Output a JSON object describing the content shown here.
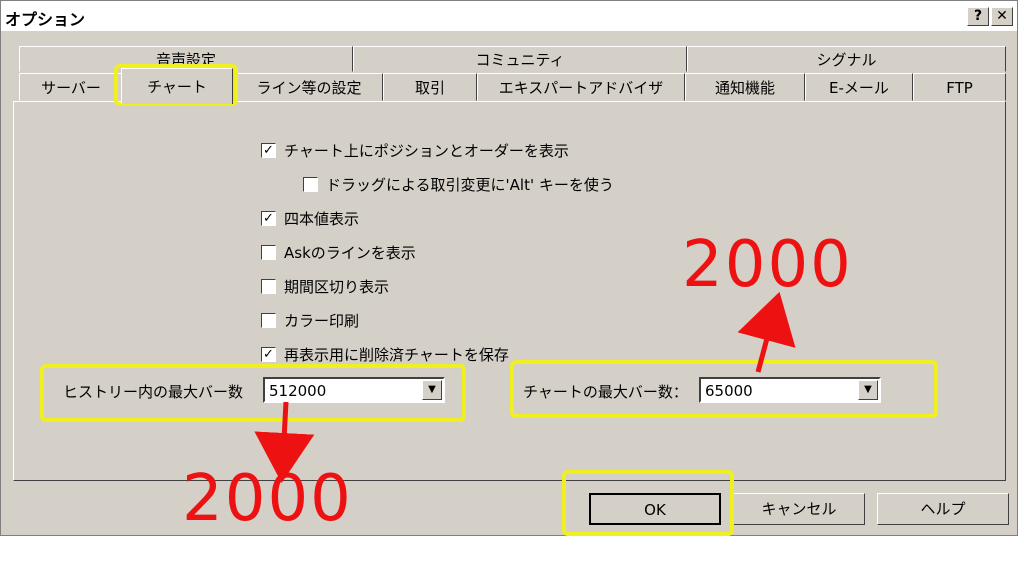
{
  "window": {
    "title": "オプション",
    "help_label": "?",
    "close_label": "✕"
  },
  "tabs_row1": [
    {
      "label": "音声設定"
    },
    {
      "label": "コミュニティ"
    },
    {
      "label": "シグナル"
    }
  ],
  "tabs_row2": [
    {
      "label": "サーバー"
    },
    {
      "label": "チャート"
    },
    {
      "label": "ライン等の設定"
    },
    {
      "label": "取引"
    },
    {
      "label": "エキスパートアドバイザ"
    },
    {
      "label": "通知機能"
    },
    {
      "label": "E-メール"
    },
    {
      "label": "FTP"
    }
  ],
  "selected_tab": "チャート",
  "checkboxes": [
    {
      "label": "チャート上にポジションとオーダーを表示",
      "checked": true,
      "mark": "✓"
    },
    {
      "label": "ドラッグによる取引変更に'Alt' キーを使う",
      "checked": false,
      "mark": ""
    },
    {
      "label": "四本値表示",
      "checked": true,
      "mark": "✓"
    },
    {
      "label": "Askのラインを表示",
      "checked": false,
      "mark": ""
    },
    {
      "label": "期間区切り表示",
      "checked": false,
      "mark": ""
    },
    {
      "label": "カラー印刷",
      "checked": false,
      "mark": ""
    },
    {
      "label": "再表示用に削除済チャートを保存",
      "checked": true,
      "mark": "✓"
    }
  ],
  "history_bars": {
    "label": "ヒストリー内の最大バー数",
    "value": "512000",
    "arrow": "▼"
  },
  "chart_bars": {
    "label": "チャートの最大バー数：",
    "value": "65000",
    "arrow": "▼"
  },
  "buttons": {
    "ok": "OK",
    "cancel": "キャンセル",
    "help": "ヘルプ"
  },
  "annotations": {
    "bottom": "2000",
    "top": "2000",
    "color": "#ee1111",
    "highlight_color": "#f0f020"
  }
}
